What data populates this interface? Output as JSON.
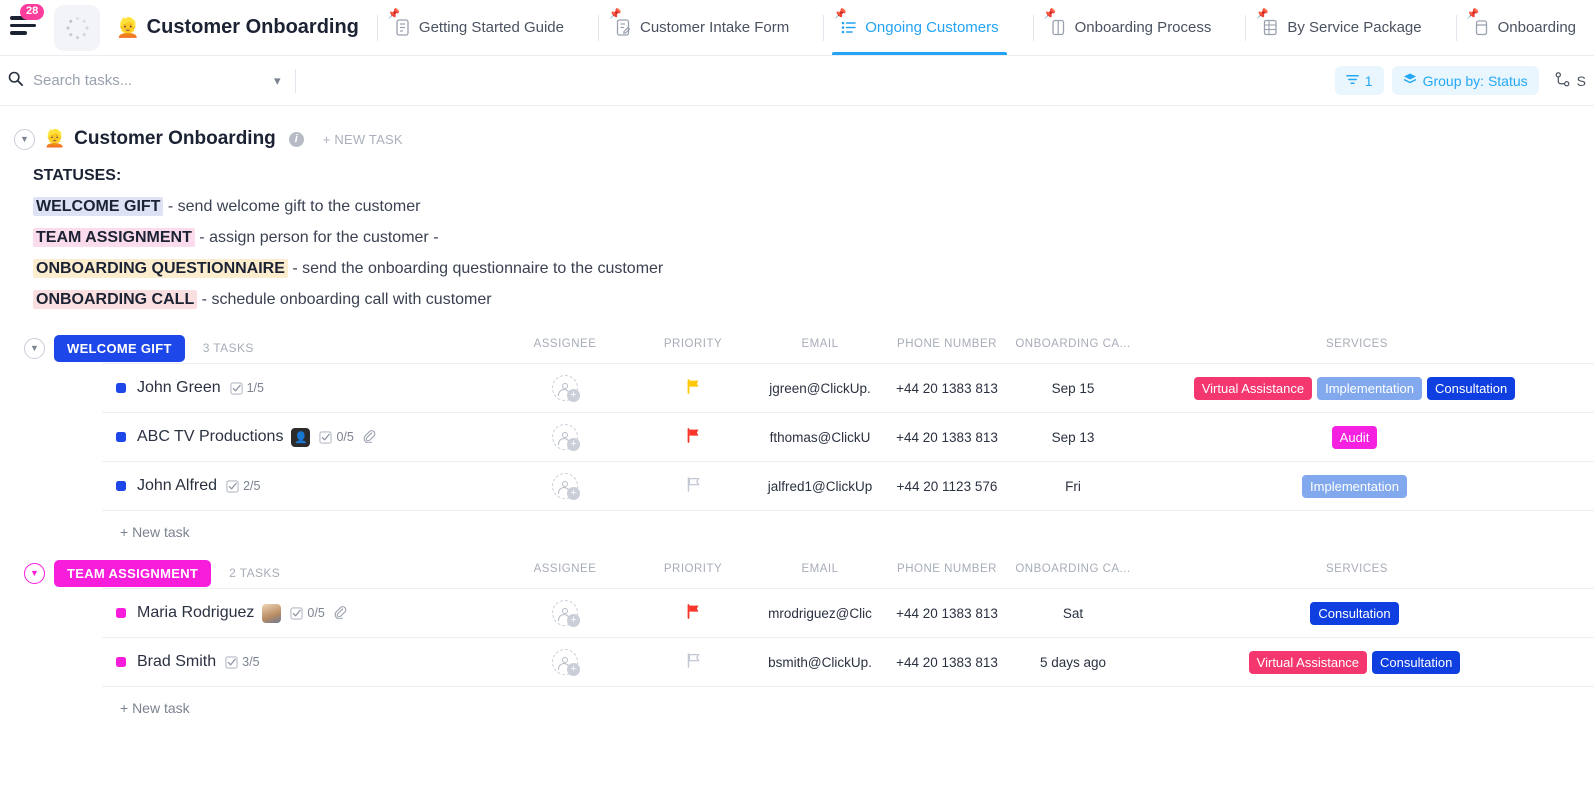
{
  "topbar": {
    "menu_badge": "28",
    "list_emoji": "👱",
    "list_title": "Customer Onboarding",
    "tabs": [
      {
        "label": "Getting Started Guide",
        "icon": "doc-icon",
        "active": false
      },
      {
        "label": "Customer Intake Form",
        "icon": "form-icon",
        "active": false
      },
      {
        "label": "Ongoing Customers",
        "icon": "list-icon",
        "active": true
      },
      {
        "label": "Onboarding Process",
        "icon": "board-icon",
        "active": false
      },
      {
        "label": "By Service Package",
        "icon": "table-icon",
        "active": false
      },
      {
        "label": "Onboarding",
        "icon": "calendar-icon",
        "active": false
      }
    ],
    "next_arrow": "❯"
  },
  "filterbar": {
    "search_placeholder": "Search tasks...",
    "search_value": "",
    "filter_count": "1",
    "group_by": "Group by: Status",
    "subtasks_label": "S"
  },
  "list_header": {
    "emoji": "👱",
    "name": "Customer Onboarding",
    "new_task": "+ NEW TASK"
  },
  "description": {
    "heading": "STATUSES:",
    "lines": [
      {
        "tag": "WELCOME GIFT",
        "tag_bg": "#dde3f5",
        "rest": " - send welcome gift to the customer"
      },
      {
        "tag": "TEAM ASSIGNMENT",
        "tag_bg": "#fbdcec",
        "rest": " - assign person for the customer -"
      },
      {
        "tag": "ONBOARDING QUESTIONNAIRE",
        "tag_bg": "#fdedcf",
        "rest": " - send the onboarding questionnaire to the customer"
      },
      {
        "tag": "ONBOARDING CALL",
        "tag_bg": "#fadfe0",
        "rest": " - schedule onboarding call with customer"
      }
    ]
  },
  "columns": [
    "ASSIGNEE",
    "PRIORITY",
    "EMAIL",
    "PHONE NUMBER",
    "ONBOARDING CA...",
    "SERVICES"
  ],
  "groups": [
    {
      "status": "WELCOME GIFT",
      "color": "#1d47e8",
      "count": "3 TASKS",
      "new_task": "+ New task",
      "tasks": [
        {
          "name": "John Green",
          "subtasks": "1/5",
          "has_attachment": false,
          "avatar_badge": null,
          "priority": "normal",
          "email": "jgreen@ClickUp.",
          "phone": "+44 20 1383 813",
          "onboarding_call": "Sep 15",
          "services": [
            {
              "label": "Virtual Assistance",
              "color": "#f4376f"
            },
            {
              "label": "Implementation",
              "color": "#82a9ee"
            },
            {
              "label": "Consultation",
              "color": "#0f3fe0"
            }
          ]
        },
        {
          "name": "ABC TV Productions",
          "subtasks": "0/5",
          "has_attachment": true,
          "avatar_badge": "dark",
          "priority": "urgent",
          "email": "fthomas@ClickU",
          "phone": "+44 20 1383 813",
          "onboarding_call": "Sep 13",
          "services": [
            {
              "label": "Audit",
              "color": "#f520e0"
            }
          ]
        },
        {
          "name": "John Alfred",
          "subtasks": "2/5",
          "has_attachment": false,
          "avatar_badge": null,
          "priority": "none",
          "email": "jalfred1@ClickUp",
          "phone": "+44 20 1123 576",
          "onboarding_call": "Fri",
          "services": [
            {
              "label": "Implementation",
              "color": "#82a9ee"
            }
          ]
        }
      ]
    },
    {
      "status": "TEAM ASSIGNMENT",
      "color": "#f81cdb",
      "count": "2 TASKS",
      "new_task": "+ New task",
      "tasks": [
        {
          "name": "Maria Rodriguez",
          "subtasks": "0/5",
          "has_attachment": true,
          "avatar_badge": "photo",
          "priority": "urgent",
          "email": "mrodriguez@Clic",
          "phone": "+44 20 1383 813",
          "onboarding_call": "Sat",
          "services": [
            {
              "label": "Consultation",
              "color": "#0f3fe0"
            }
          ]
        },
        {
          "name": "Brad Smith",
          "subtasks": "3/5",
          "has_attachment": false,
          "avatar_badge": null,
          "priority": "none",
          "email": "bsmith@ClickUp.",
          "phone": "+44 20 1383 813",
          "onboarding_call": "5 days ago",
          "services": [
            {
              "label": "Virtual Assistance",
              "color": "#f4376f"
            },
            {
              "label": "Consultation",
              "color": "#0f3fe0"
            }
          ]
        }
      ]
    }
  ]
}
